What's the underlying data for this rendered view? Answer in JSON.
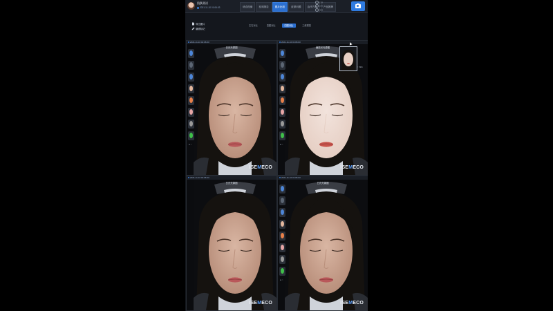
{
  "header": {
    "user_name": "肌肤测试",
    "user_date": "2021-11-10 01:06:03",
    "tabs": [
      {
        "label": "综合档案",
        "active": false
      },
      {
        "label": "检测报告",
        "active": false
      },
      {
        "label": "图片比较",
        "active": true
      },
      {
        "label": "皮肤问题",
        "active": false
      },
      {
        "label": "治疗方案",
        "active": false
      },
      {
        "label": "产品推荐",
        "active": false
      }
    ],
    "stats": [
      "159",
      "226",
      "453"
    ],
    "camera_icon": "camera-icon"
  },
  "toolbar": {
    "export_label": "导出图片",
    "edit_label": "编辑标记",
    "view_tabs": [
      {
        "label": "左右对比",
        "active": false
      },
      {
        "label": "四图对比",
        "active": false
      },
      {
        "label": "四图对比",
        "active": true
      },
      {
        "label": "三维模型",
        "active": false
      }
    ]
  },
  "panels": [
    {
      "date": "2021-11-10 01:06:03",
      "title": "日光光源图",
      "variant": "normal",
      "thumbs": true
    },
    {
      "date": "2021-11-10 01:06:03",
      "title": "偏振光光源图",
      "variant": "bright",
      "thumbs": true,
      "inset_label": "↑ 59%"
    },
    {
      "date": "2021-11-10 01:06:03",
      "title": "日光光源图",
      "variant": "normal",
      "thumbs": false
    },
    {
      "date": "2021-11-10 01:06:03",
      "title": "日光光源图",
      "variant": "normal",
      "thumbs": true
    }
  ],
  "brand": {
    "part1": "ISE",
    "part2": "M",
    "part3": "ECO"
  },
  "colors": {
    "accent": "#2b6fd0",
    "background": "#14171d"
  }
}
